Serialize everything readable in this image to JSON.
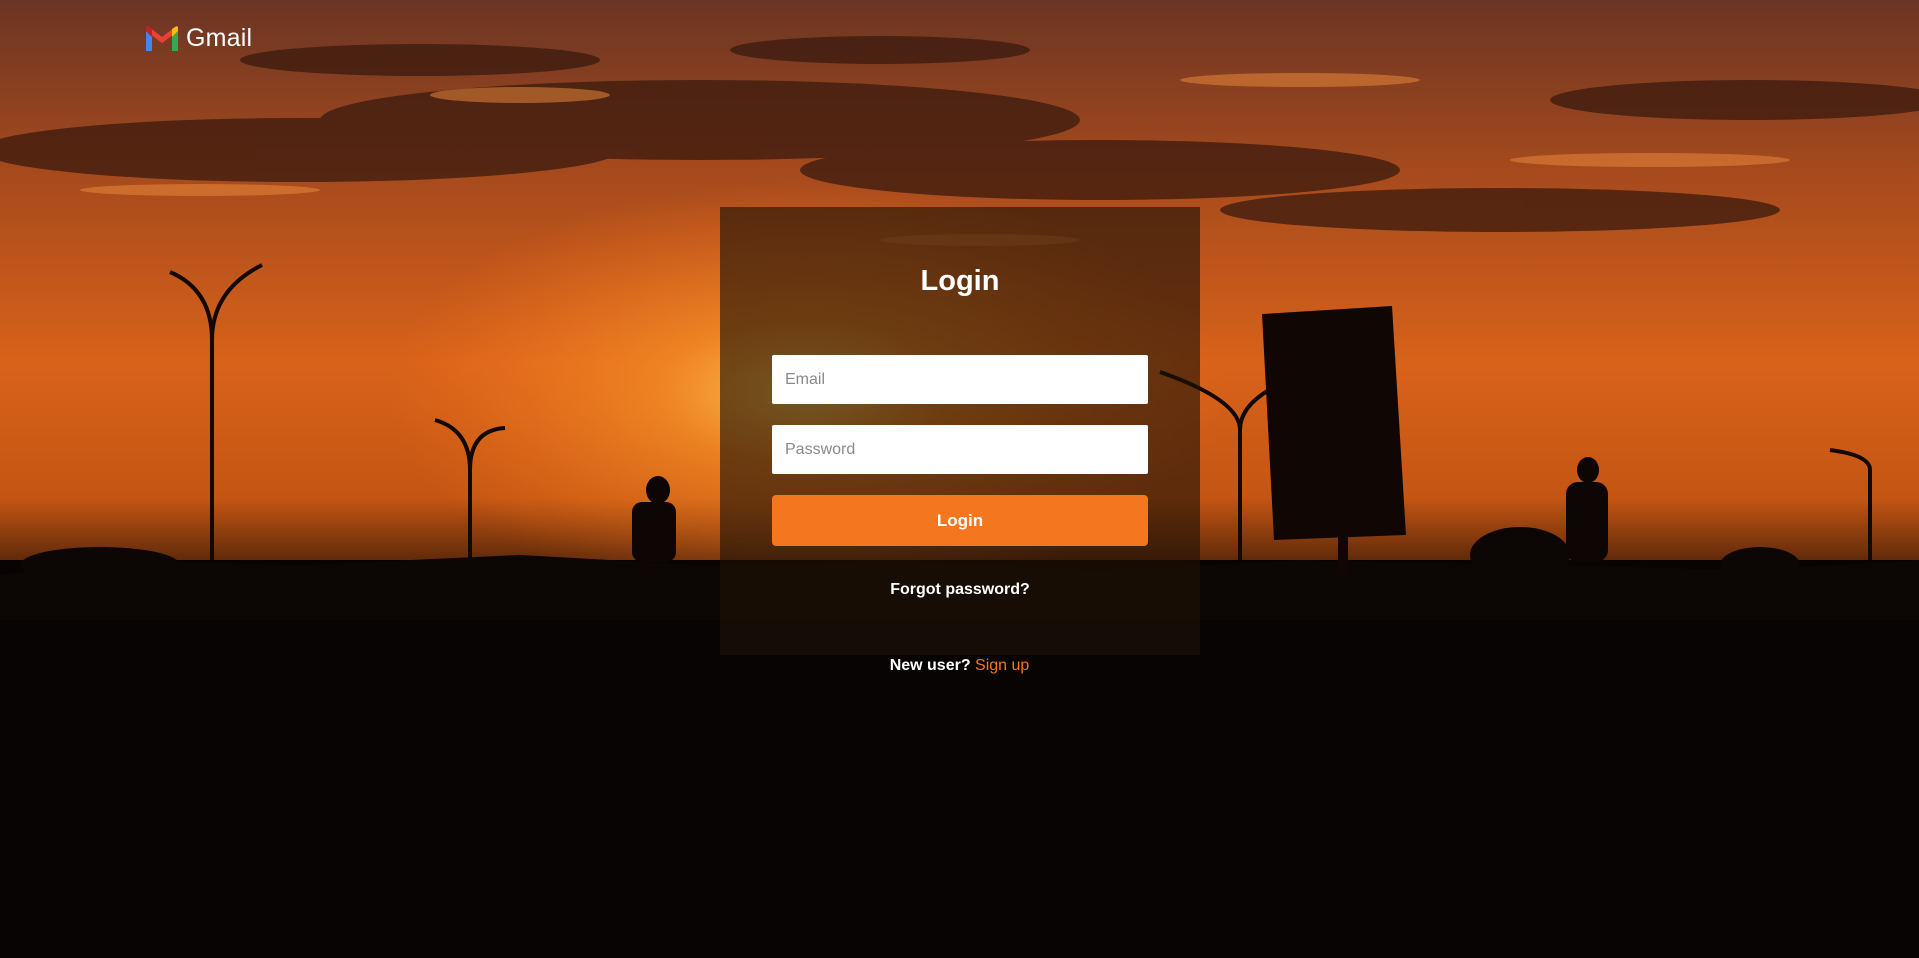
{
  "brand": {
    "logo_text": "Gmail",
    "logo_icon": "gmail-m-icon"
  },
  "login": {
    "title": "Login",
    "email_placeholder": "Email",
    "password_placeholder": "Password",
    "button_label": "Login",
    "forgot_label": "Forgot password?"
  },
  "signup": {
    "prompt": "New user?",
    "link_label": "Sign up"
  },
  "colors": {
    "accent": "#f4761e",
    "card_overlay": "rgba(30,18,6,0.62)"
  }
}
